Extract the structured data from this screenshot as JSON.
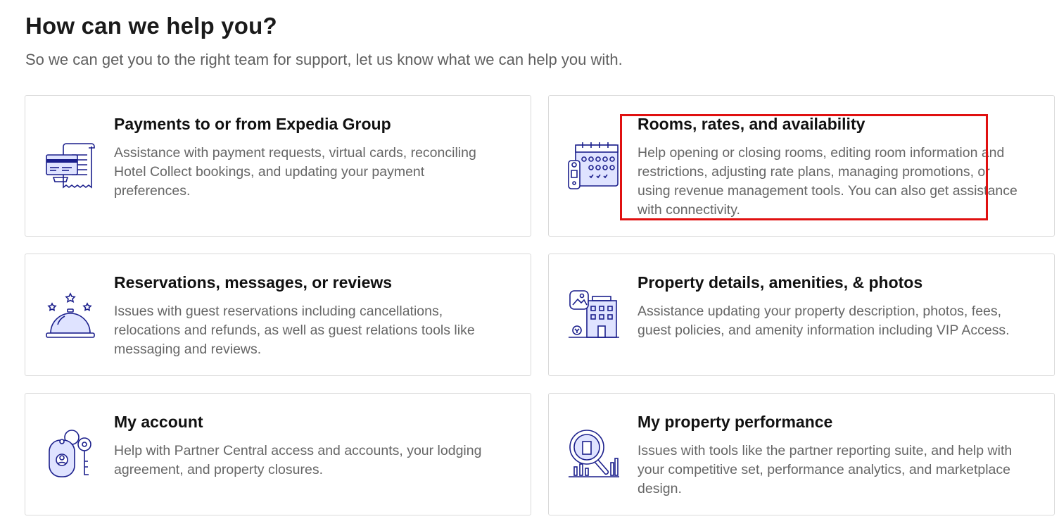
{
  "header": {
    "title": "How can we help you?",
    "subtitle": "So we can get you to the right team for support, let us know what we can help you with."
  },
  "cards": [
    {
      "title": "Payments to or from Expedia Group",
      "description": "Assistance with payment requests, virtual cards, reconciling Hotel Collect bookings, and updating your payment preferences.",
      "icon": "payment-card-receipt-icon"
    },
    {
      "title": "Rooms, rates, and availability",
      "description": "Help opening or closing rooms, editing room information and restrictions, adjusting rate plans, managing promotions, or using revenue management tools. You can also get assistance with connectivity.",
      "icon": "calendar-key-icon"
    },
    {
      "title": "Reservations, messages, or reviews",
      "description": "Issues with guest reservations including cancellations, relocations and refunds, as well as guest relations tools like messaging and reviews.",
      "icon": "service-bell-icon"
    },
    {
      "title": "Property details, amenities, & photos",
      "description": "Assistance updating your property description, photos, fees, guest policies, and amenity information including VIP Access.",
      "icon": "building-photo-icon"
    },
    {
      "title": "My account",
      "description": "Help with Partner Central access and accounts, your lodging agreement, and property closures.",
      "icon": "keys-icon"
    },
    {
      "title": "My property performance",
      "description": "Issues with tools like the partner reporting suite, and help with your competitive set, performance analytics, and marketplace design.",
      "icon": "magnifier-chart-icon"
    }
  ],
  "colors": {
    "icon_stroke": "#1b1f8c",
    "icon_fill": "#dfe3ff",
    "highlight": "#e01010",
    "border": "#dadada"
  }
}
